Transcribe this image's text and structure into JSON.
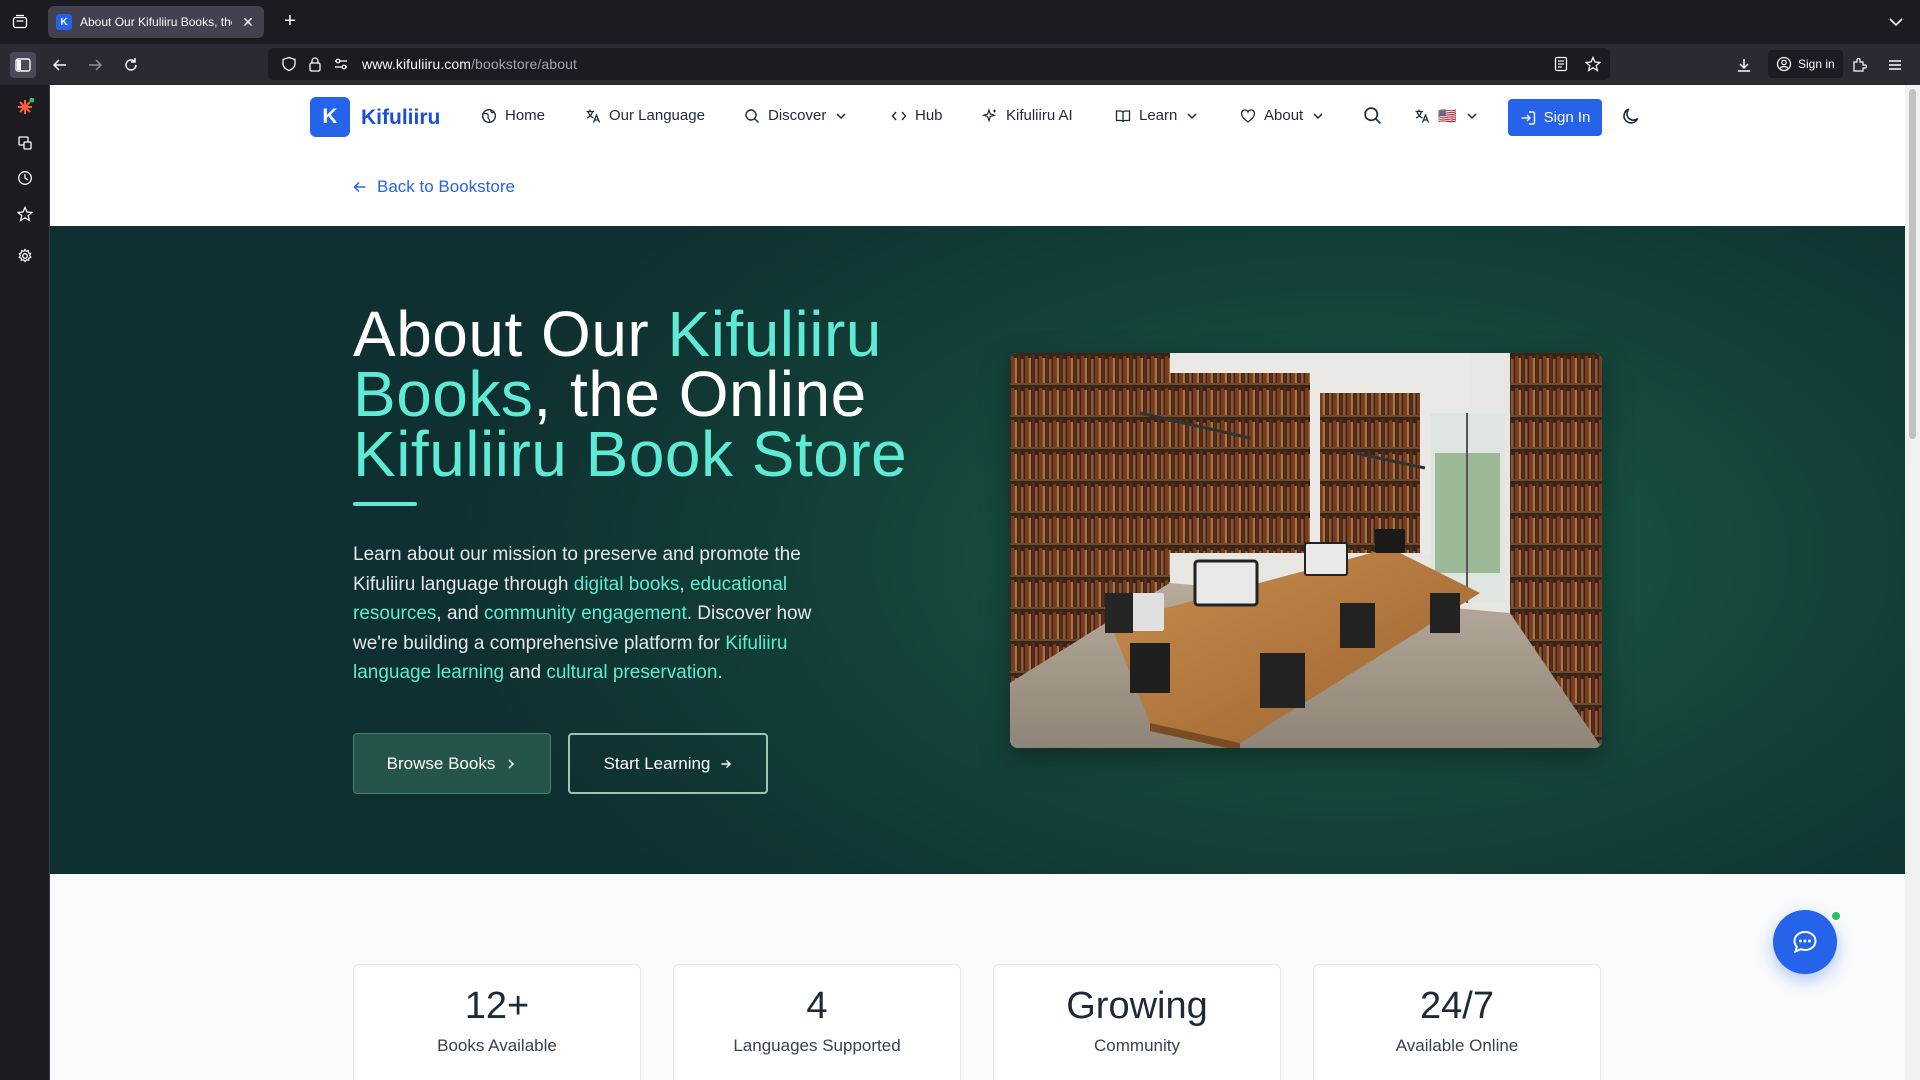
{
  "browser": {
    "tab_title": "About Our Kifuliiru Books, the O",
    "tab_favicon_letter": "K",
    "url_domain": "www.kifuliiru.com",
    "url_path": "/bookstore/about",
    "account_label": "Sign in"
  },
  "site": {
    "logo_letter": "K",
    "brand": "Kifuliiru",
    "nav": {
      "home": "Home",
      "our_language": "Our Language",
      "discover": "Discover",
      "hub": "Hub",
      "ai": "Kifuliiru AI",
      "learn": "Learn",
      "about": "About",
      "locale_flag": "🇺🇸"
    },
    "sign_in": "Sign In"
  },
  "back_link": "Back to Bookstore",
  "hero": {
    "title_1": "About Our ",
    "title_2": "Kifuliiru Books",
    "title_3": ", the Online ",
    "title_4": "Kifuliiru Book Store",
    "desc_1": "Learn about our mission to preserve and promote the Kifuliiru language through ",
    "desc_link_1": "digital books",
    "desc_2": ", ",
    "desc_link_2": "educational resources",
    "desc_3": ", and ",
    "desc_link_3": "community engagement",
    "desc_4": ". Discover how we're building a comprehensive platform for ",
    "desc_link_4": "Kifuliiru language learning",
    "desc_5": " and ",
    "desc_link_5": "cultural preservation",
    "desc_6": ".",
    "browse_btn": "Browse Books",
    "start_btn": "Start Learning"
  },
  "stats": [
    {
      "value": "12+",
      "label": "Books Available"
    },
    {
      "value": "4",
      "label": "Languages Supported"
    },
    {
      "value": "Growing",
      "label": "Community"
    },
    {
      "value": "24/7",
      "label": "Available Online"
    }
  ],
  "colors": {
    "brand_blue": "#2563eb",
    "accent_teal": "#5eead4",
    "hero_bg": "#174b3f"
  }
}
